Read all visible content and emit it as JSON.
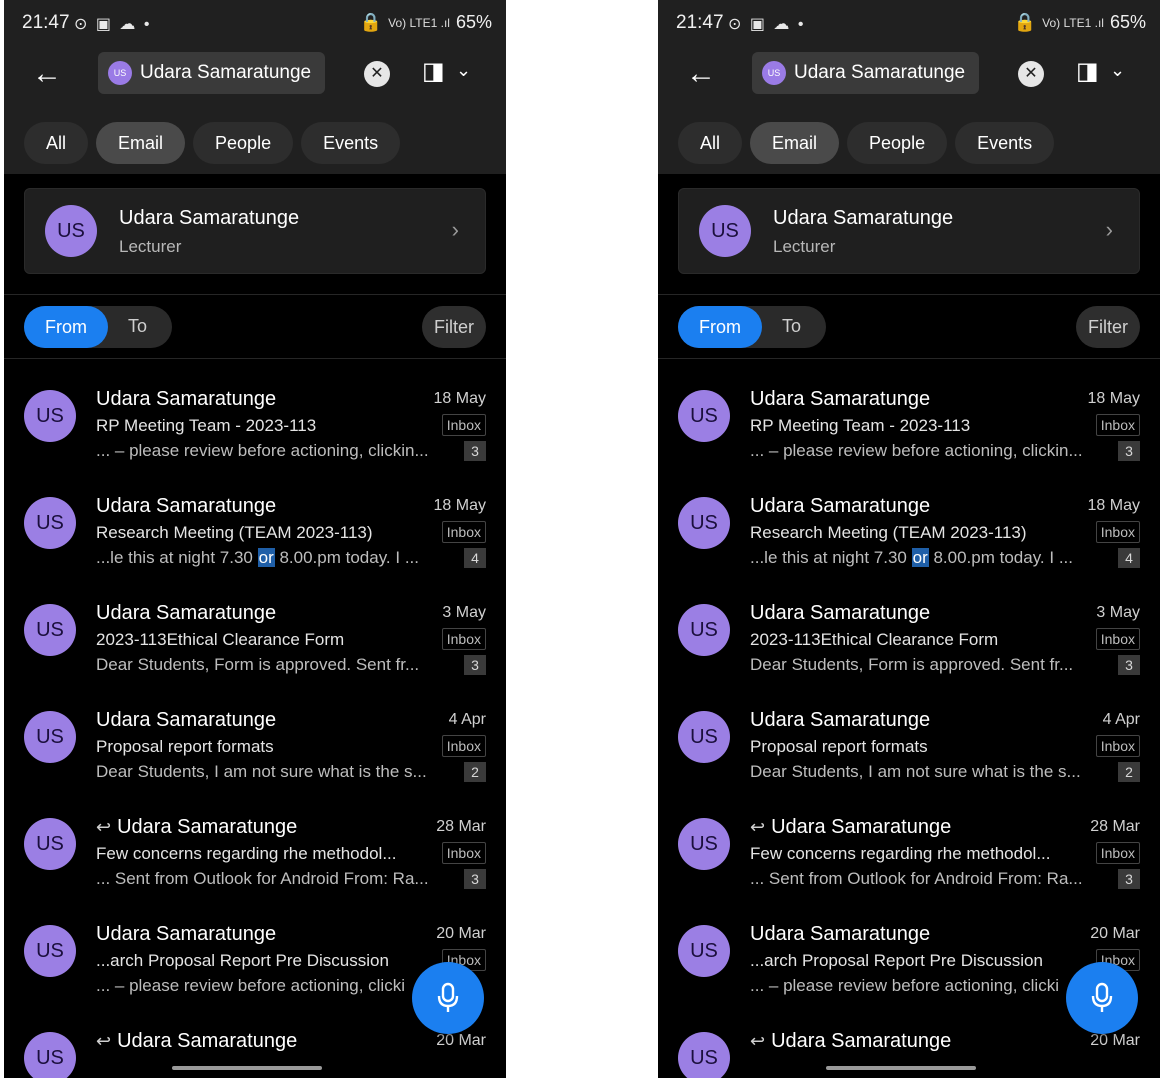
{
  "status": {
    "time": "21:47",
    "left_icons": "⊙ ▣ ☁ •",
    "battery": "65%",
    "network": "Vo) LTE1 .ıl"
  },
  "search": {
    "chip_avatar": "US",
    "chip_label": "Udara Samaratunge"
  },
  "icons": {
    "back": "arrow-left-icon",
    "clear": "close-icon",
    "office": "office-icon",
    "chevron": "chevron-down-icon",
    "mic": "microphone-icon"
  },
  "tabs": [
    "All",
    "Email",
    "People",
    "Events"
  ],
  "active_tab": "Email",
  "contact": {
    "initials": "US",
    "name": "Udara Samaratunge",
    "role": "Lecturer"
  },
  "toggle": {
    "from": "From",
    "to": "To"
  },
  "filter_label": "Filter",
  "emails": [
    {
      "initials": "US",
      "sender": "Udara Samaratunge",
      "date": "18 May",
      "subject": "RP Meeting Team - 2023-113",
      "folder": "Inbox",
      "preview": "... – please review before actioning, clickin...",
      "count": "3"
    },
    {
      "initials": "US",
      "sender": "Udara Samaratunge",
      "date": "18 May",
      "subject": "Research Meeting (TEAM 2023-113)",
      "folder": "Inbox",
      "preview_before": "...le this at night 7.30 ",
      "preview_hl": "or",
      "preview_after": " 8.00.pm today. I ...",
      "count": "4"
    },
    {
      "initials": "US",
      "sender": "Udara Samaratunge",
      "date": "3 May",
      "subject": "2023-113Ethical Clearance Form",
      "folder": "Inbox",
      "preview": "Dear Students, Form is approved. Sent fr...",
      "count": "3"
    },
    {
      "initials": "US",
      "sender": "Udara Samaratunge",
      "date": "4 Apr",
      "subject": "Proposal report formats",
      "folder": "Inbox",
      "preview": "Dear Students, I am not sure what is the s...",
      "count": "2"
    },
    {
      "initials": "US",
      "sender": "Udara Samaratunge",
      "date": "28 Mar",
      "subject": "Few concerns regarding rhe  methodol...",
      "folder": "Inbox",
      "preview": "... Sent from Outlook for Android From: Ra...",
      "count": "3",
      "reply": "↩"
    },
    {
      "initials": "US",
      "sender": "Udara Samaratunge",
      "date": "20 Mar",
      "subject": "...arch Proposal Report Pre Discussion",
      "folder": "Inbox",
      "preview": "... – please review before actioning, clicki",
      "count": ""
    },
    {
      "initials": "US",
      "sender": "Udara Samaratunge",
      "date": "20 Mar",
      "subject": "",
      "folder": "",
      "preview": "",
      "count": "",
      "reply": "↩"
    }
  ]
}
